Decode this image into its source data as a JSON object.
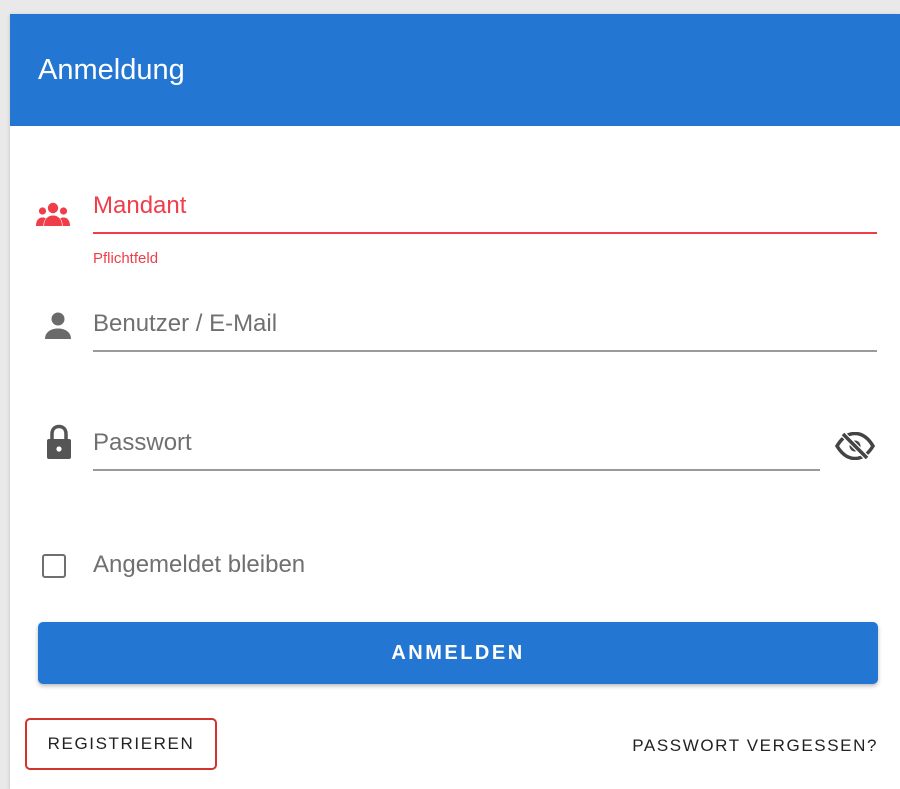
{
  "dialog": {
    "title": "Anmeldung"
  },
  "fields": {
    "mandant": {
      "placeholder": "Mandant",
      "hint": "Pflichtfeld",
      "icon": "group-icon"
    },
    "user": {
      "placeholder": "Benutzer / E-Mail",
      "icon": "person-icon"
    },
    "password": {
      "placeholder": "Passwort",
      "icon": "lock-icon",
      "toggle_icon": "eye-off-icon"
    }
  },
  "remember": {
    "label": "Angemeldet bleiben",
    "checked": false
  },
  "actions": {
    "login_label": "ANMELDEN",
    "register_label": "REGISTRIEREN",
    "forgot_label": "PASSWORT VERGESSEN?"
  },
  "colors": {
    "primary": "#2377d2",
    "error": "#ef3e4a",
    "focus_outline": "#d0342c"
  }
}
